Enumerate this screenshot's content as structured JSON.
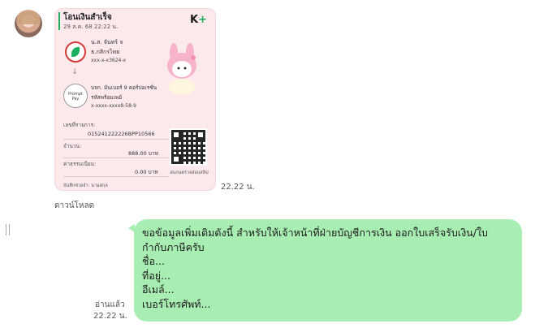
{
  "chat": {
    "time_slip": "22.22 น.",
    "download_label": "ดาวน์โหลด",
    "read_status": "อ่านแล้ว",
    "time_message": "22.22 น."
  },
  "slip": {
    "title": "โอนเงินสำเร็จ",
    "date": "29 ส.ค. 68  22:22 น.",
    "brand": "K+",
    "from_name": "น.ส. จันทร์ จ",
    "from_bank": "ธ.กสิกรไทย",
    "from_account": "xxx-x-x3624-x",
    "promptpay_label": "Prompt Pay",
    "to_name": "บจก. มันเบอร์ 9 คอร์ปอเรชั่น",
    "to_bank": "รหัสพร้อมเพย์",
    "to_account": "x-xxxx-xxxx8-58-9",
    "ref_label": "เลขที่รายการ:",
    "ref_value": "015241222226BPP10566",
    "amount_label": "จำนวน:",
    "amount_value": "888.00 บาท",
    "fee_label": "ค่าธรรมเนียม:",
    "fee_value": "0.00 บาท",
    "qr_caption": "สแกนตรวจสอบสลิป",
    "memo": "บันทึกช่วยจำ: นามสกุล"
  },
  "message": {
    "lines": [
      "ขอข้อมูลเพิ่มเติมดังนี้ สำหรับให้เจ้าหน้าที่ฝ่ายบัญชีการเงิน ออกใบเสร็จรับเงิน/ใบ",
      "กำกับภาษีครับ",
      "ชื่อ...",
      "ที่อยู่...",
      "อีเมล์...",
      "เบอร์โทรศัพท์..."
    ]
  },
  "icons": {
    "avatar": "user-avatar",
    "bank": "kasikorn-bank-icon",
    "promptpay": "promptpay-icon",
    "arrow": "arrow-down-icon",
    "qr": "qr-code-icon",
    "sticker": "my-melody-sticker",
    "handle": "drag-handle-icon"
  },
  "colors": {
    "slip_bg": "#fbe9ec",
    "bubble": "#a8edb2",
    "kplus_green": "#1bae5f"
  }
}
